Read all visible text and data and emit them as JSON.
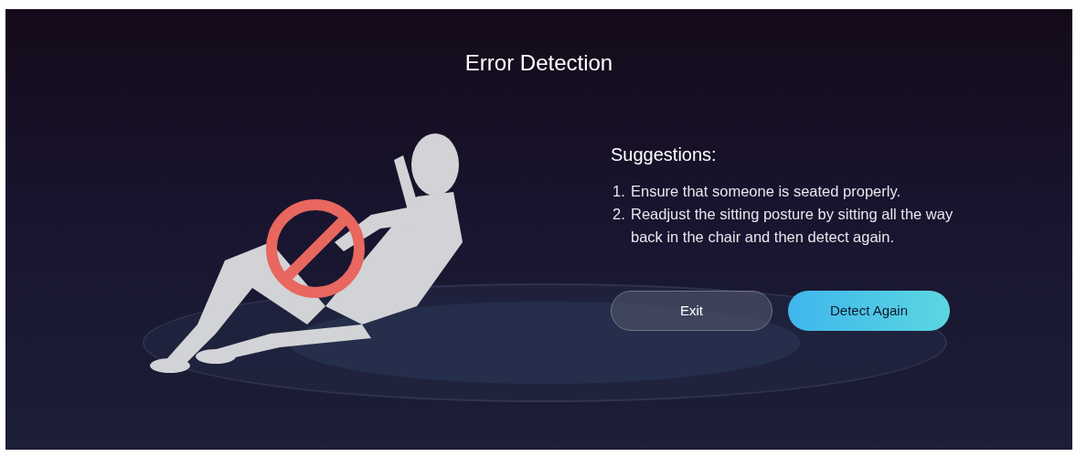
{
  "title": "Error Detection",
  "suggestions": {
    "heading": "Suggestions:",
    "items": [
      {
        "number": "1.",
        "text": "Ensure that someone is seated properly."
      },
      {
        "number": "2.",
        "text": "Readjust the sitting posture by sitting all the way back in the chair and then detect again."
      }
    ]
  },
  "buttons": [
    {
      "label": "Exit",
      "kind": "secondary"
    },
    {
      "label": "Detect Again",
      "kind": "primary"
    }
  ]
}
